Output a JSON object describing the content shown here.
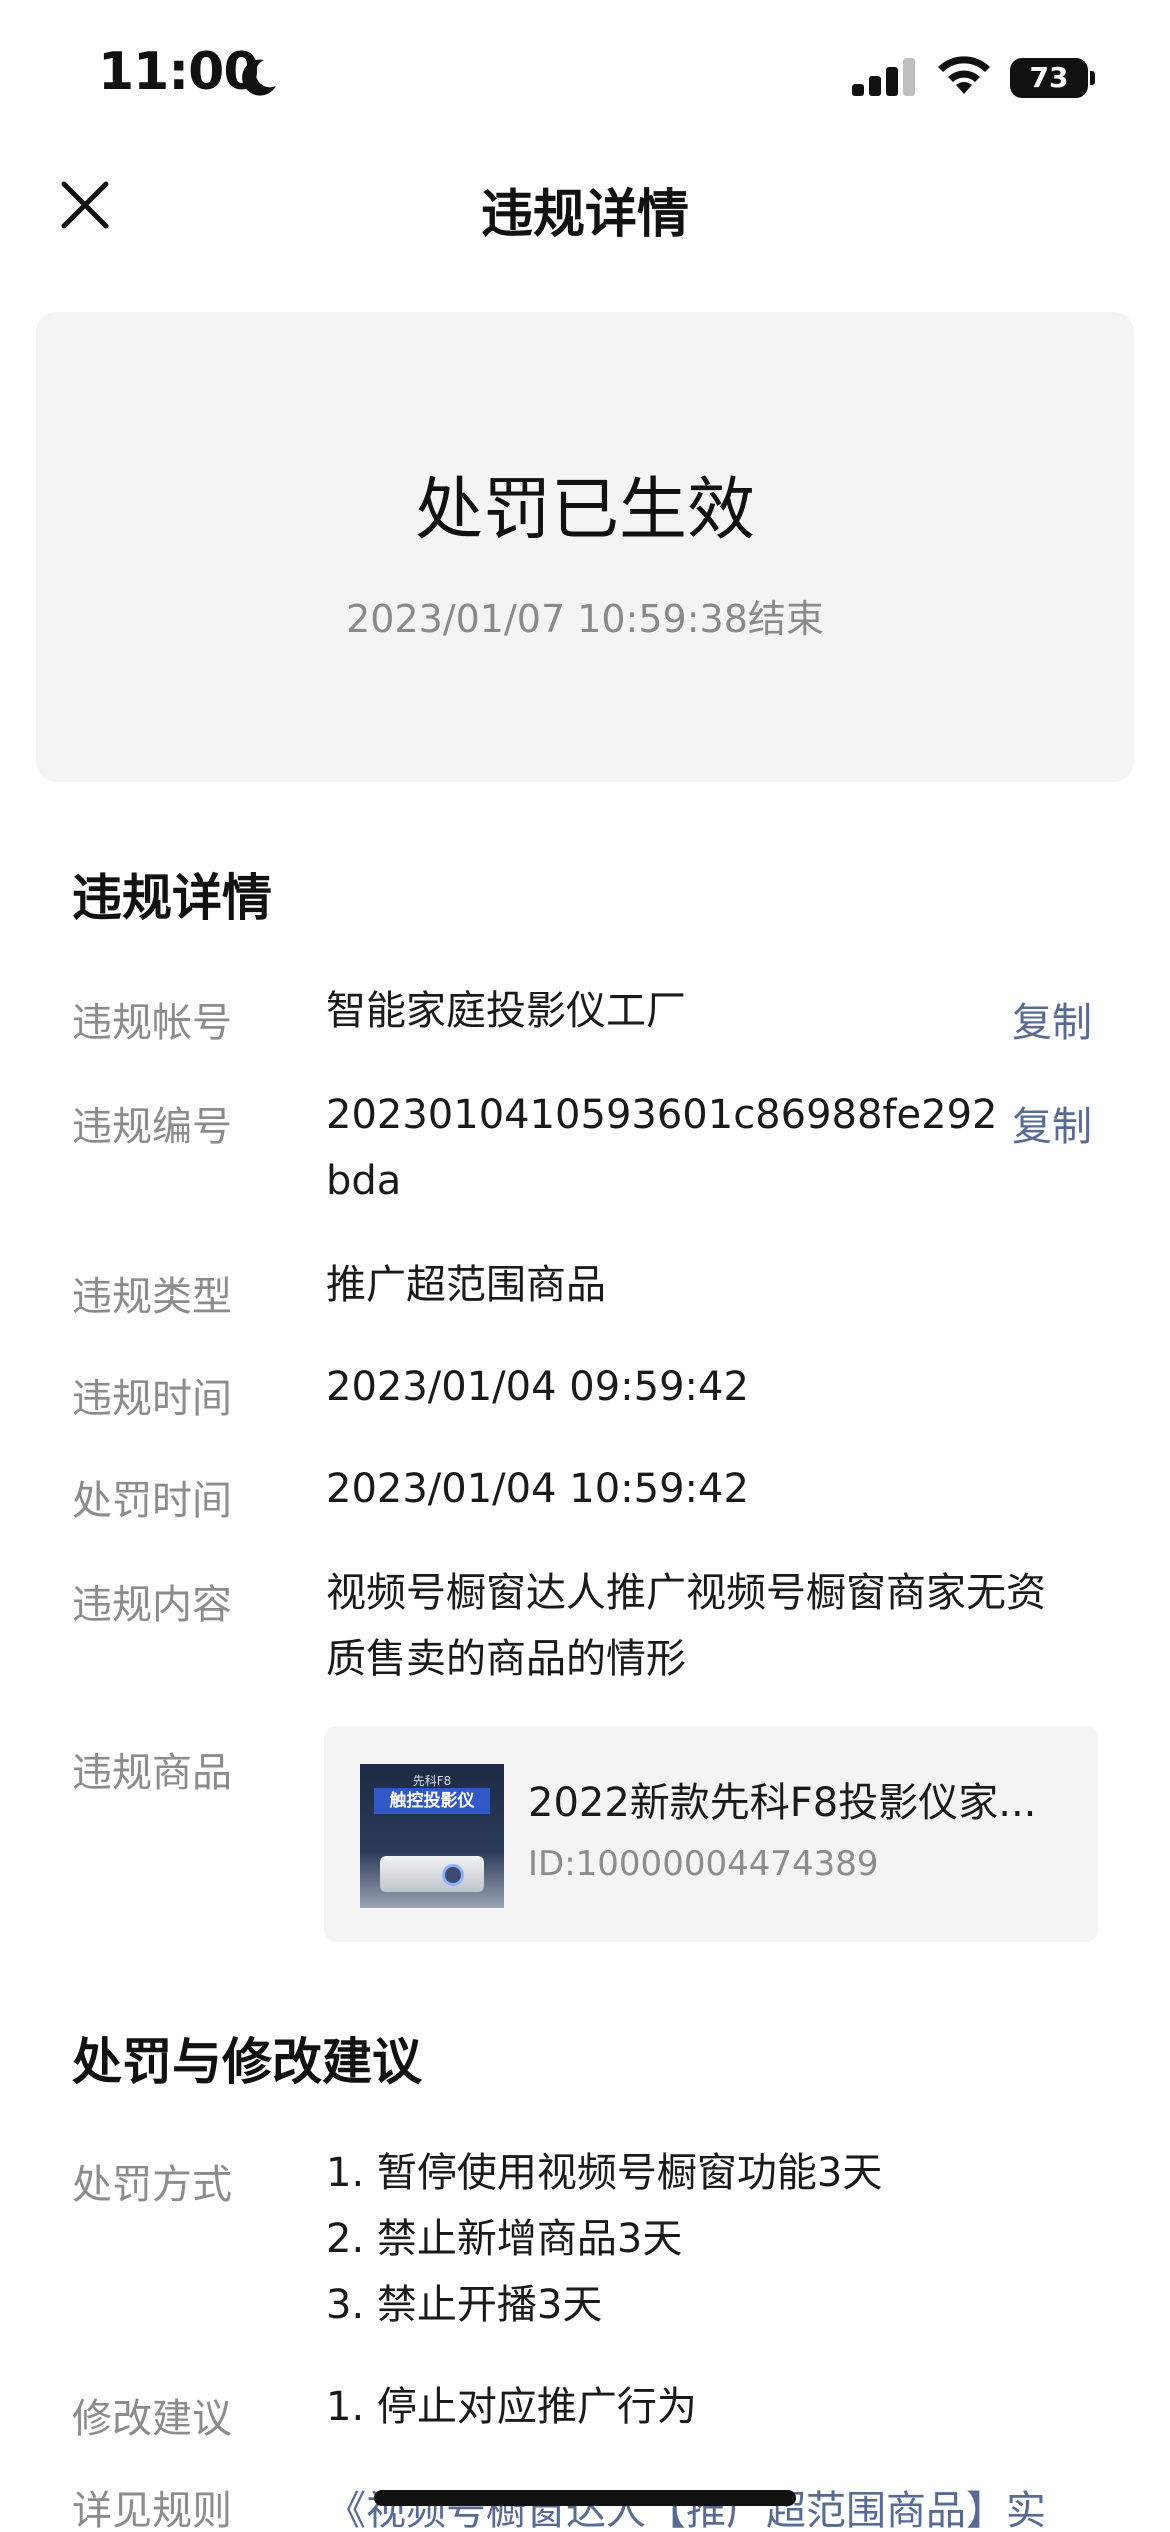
{
  "status_bar": {
    "time": "11:00",
    "battery": "73",
    "icons": [
      "moon-icon",
      "signal-icon",
      "wifi-icon",
      "battery-icon"
    ]
  },
  "nav": {
    "title": "违规详情",
    "close_icon": "close-icon"
  },
  "status_card": {
    "title": "处罚已生效",
    "subtitle": "2023/01/07 10:59:38结束"
  },
  "violation_section": {
    "title": "违规详情",
    "copy_label": "复制",
    "rows": {
      "account": {
        "label": "违规帐号",
        "value": "智能家庭投影仪工厂"
      },
      "number": {
        "label": "违规编号",
        "value_line1": "2023010410593601c86988fe292",
        "value_line2": "bda"
      },
      "type": {
        "label": "违规类型",
        "value": "推广超范围商品"
      },
      "violation_time": {
        "label": "违规时间",
        "value": "2023/01/04 09:59:42"
      },
      "penalty_time": {
        "label": "处罚时间",
        "value": "2023/01/04 10:59:42"
      },
      "content": {
        "label": "违规内容",
        "value_line1": "视频号橱窗达人推广视频号橱窗商家无资",
        "value_line2": "质售卖的商品的情形"
      },
      "product": {
        "label": "违规商品"
      }
    },
    "product": {
      "name": "2022新款先科F8投影仪家...",
      "id": "ID:10000004474389",
      "thumb_brand": "先科F8",
      "thumb_label": "触控投影仪"
    }
  },
  "penalty_section": {
    "title": "处罚与修改建议",
    "method_label": "处罚方式",
    "methods": [
      "1. 暂停使用视频号橱窗功能3天",
      "2. 禁止新增商品3天",
      "3. 禁止开播3天"
    ],
    "suggestion_label": "修改建议",
    "suggestion": "1. 停止对应推广行为",
    "rules_label": "详见规则",
    "rules_link": "《视频号橱窗达人【推广超范围商品】实"
  }
}
